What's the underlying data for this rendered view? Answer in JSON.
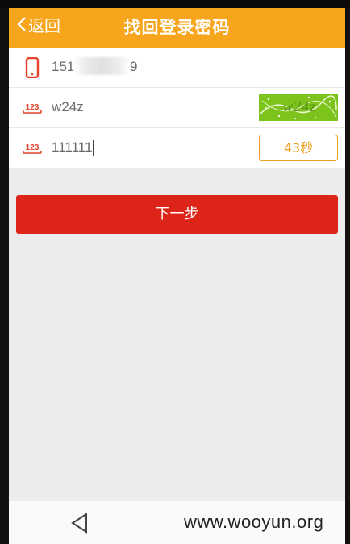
{
  "header": {
    "back_label": "返回",
    "title": "找回登录密码",
    "color": "#f7a51c"
  },
  "form": {
    "phone": {
      "icon": "phone-icon",
      "value_prefix": "151",
      "value_suffix": "9"
    },
    "captcha": {
      "icon": "number-123-icon",
      "value": "w24z",
      "image_text": "w24z"
    },
    "sms_code": {
      "icon": "number-123-icon",
      "value": "111111",
      "countdown_label": "43秒"
    }
  },
  "actions": {
    "next_label": "下一步",
    "next_color": "#dc2518"
  },
  "system_nav": {
    "back_icon": "triangle-back-icon"
  },
  "watermark": "www.wooyun.org"
}
